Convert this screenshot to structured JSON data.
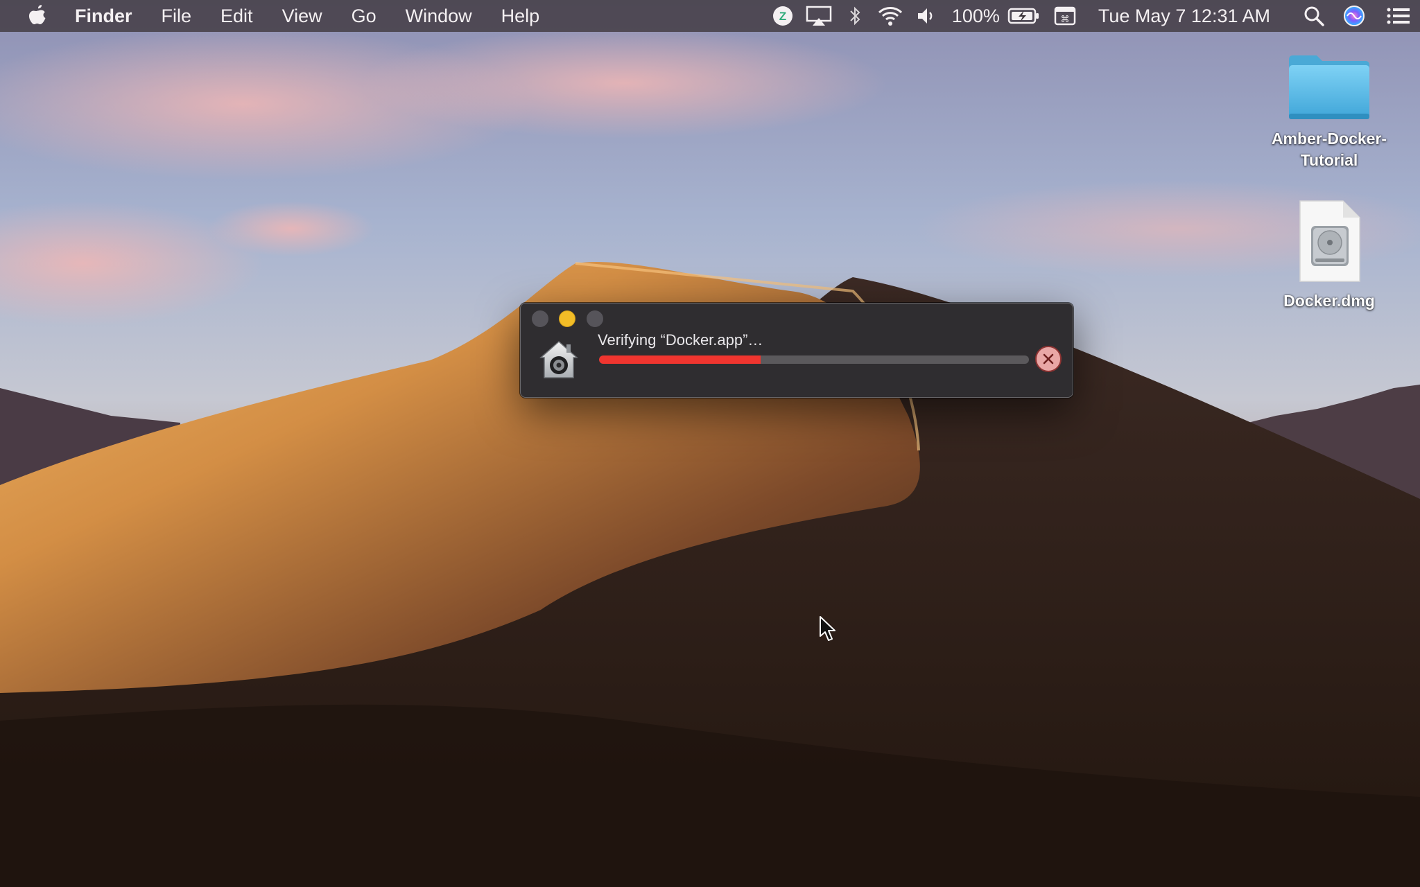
{
  "menubar": {
    "apple_icon": "apple-logo-icon",
    "app_name": "Finder",
    "menus": [
      "File",
      "Edit",
      "View",
      "Go",
      "Window",
      "Help"
    ],
    "status": {
      "icons": [
        "zoom-icon",
        "airplay-icon",
        "bluetooth-icon",
        "wifi-icon",
        "volume-icon",
        "battery-icon",
        "keyboard-shortcut-icon",
        "spotlight-search-icon",
        "siri-icon",
        "notification-center-icon"
      ],
      "battery_percent": "100%",
      "datetime": "Tue May 7  12:31 AM"
    }
  },
  "desktop": {
    "items": [
      {
        "label_line1": "Amber-Docker-",
        "label_line2": "Tutorial",
        "kind": "folder"
      },
      {
        "label_line1": "Docker.dmg",
        "label_line2": "",
        "kind": "disk-image"
      }
    ]
  },
  "dialog": {
    "title": "Verifying “Docker.app”…",
    "progress": 0.375,
    "colors": {
      "progress": "#f0352f",
      "track": "#5b595c",
      "background": "#2f2d30"
    }
  }
}
